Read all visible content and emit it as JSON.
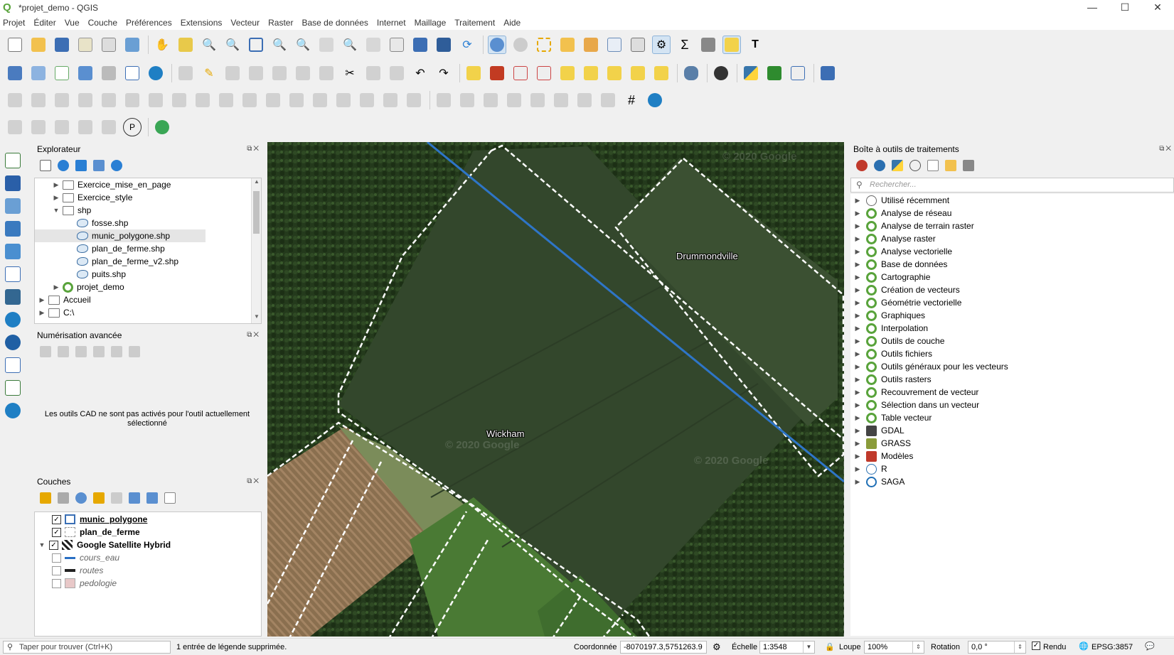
{
  "window": {
    "title": "*projet_demo - QGIS",
    "minimize": "—",
    "maximize": "☐",
    "close": "✕"
  },
  "menu": [
    "Projet",
    "Éditer",
    "Vue",
    "Couche",
    "Préférences",
    "Extensions",
    "Vecteur",
    "Raster",
    "Base de données",
    "Internet",
    "Maillage",
    "Traitement",
    "Aide"
  ],
  "explorer": {
    "title": "Explorateur",
    "items": [
      {
        "label": "Exercice_mise_en_page"
      },
      {
        "label": "Exercice_style"
      },
      {
        "label": "shp"
      },
      {
        "label": "fosse.shp"
      },
      {
        "label": "munic_polygone.shp"
      },
      {
        "label": "plan_de_ferme.shp"
      },
      {
        "label": "plan_de_ferme_v2.shp"
      },
      {
        "label": "puits.shp"
      },
      {
        "label": "projet_demo"
      },
      {
        "label": "Accueil"
      },
      {
        "label": "C:\\"
      }
    ]
  },
  "advanced_digitizing": {
    "title": "Numérisation avancée",
    "message": "Les outils CAD ne sont pas activés pour l'outil actuellement sélectionné"
  },
  "layers": {
    "title": "Couches",
    "items": [
      {
        "name": "munic_polygone",
        "checked": true
      },
      {
        "name": "plan_de_ferme",
        "checked": true
      },
      {
        "name": "Google Satellite Hybrid",
        "checked": true
      },
      {
        "name": "cours_eau",
        "checked": false
      },
      {
        "name": "routes",
        "checked": false
      },
      {
        "name": "pedologie",
        "checked": false
      }
    ]
  },
  "map": {
    "labels": [
      "Drummondville",
      "Wickham"
    ],
    "watermark": "© 2020 Google"
  },
  "processing": {
    "title": "Boîte à outils de traitements",
    "search_placeholder": "Rechercher...",
    "items": [
      {
        "label": "Utilisé récemment",
        "icon": "clock-icon"
      },
      {
        "label": "Analyse de réseau",
        "icon": "qgis-icon"
      },
      {
        "label": "Analyse de terrain raster",
        "icon": "qgis-icon"
      },
      {
        "label": "Analyse raster",
        "icon": "qgis-icon"
      },
      {
        "label": "Analyse vectorielle",
        "icon": "qgis-icon"
      },
      {
        "label": "Base de données",
        "icon": "qgis-icon"
      },
      {
        "label": "Cartographie",
        "icon": "qgis-icon"
      },
      {
        "label": "Création de vecteurs",
        "icon": "qgis-icon"
      },
      {
        "label": "Géométrie vectorielle",
        "icon": "qgis-icon"
      },
      {
        "label": "Graphiques",
        "icon": "qgis-icon"
      },
      {
        "label": "Interpolation",
        "icon": "qgis-icon"
      },
      {
        "label": "Outils de couche",
        "icon": "qgis-icon"
      },
      {
        "label": "Outils fichiers",
        "icon": "qgis-icon"
      },
      {
        "label": "Outils généraux pour les vecteurs",
        "icon": "qgis-icon"
      },
      {
        "label": "Outils rasters",
        "icon": "qgis-icon"
      },
      {
        "label": "Recouvrement de vecteur",
        "icon": "qgis-icon"
      },
      {
        "label": "Sélection dans un vecteur",
        "icon": "qgis-icon"
      },
      {
        "label": "Table vecteur",
        "icon": "qgis-icon"
      },
      {
        "label": "GDAL",
        "icon": "gdal-icon"
      },
      {
        "label": "GRASS",
        "icon": "grass-icon"
      },
      {
        "label": "Modèles",
        "icon": "models-icon"
      },
      {
        "label": "R",
        "icon": "r-icon"
      },
      {
        "label": "SAGA",
        "icon": "saga-icon"
      }
    ]
  },
  "status": {
    "search_placeholder": "Taper pour trouver (Ctrl+K)",
    "message": "1 entrée de légende supprimée.",
    "coord_label": "Coordonnée",
    "coord_value": "-8070197.3,5751263.9",
    "scale_label": "Échelle",
    "scale_value": "1:3548",
    "magnifier_label": "Loupe",
    "magnifier_value": "100%",
    "rotation_label": "Rotation",
    "rotation_value": "0,0 °",
    "render_label": "Rendu",
    "crs": "EPSG:3857"
  }
}
